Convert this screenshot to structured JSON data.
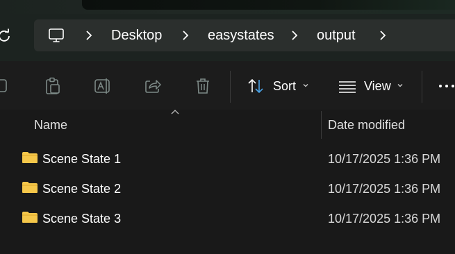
{
  "colors": {
    "background": "#191919",
    "folder": "#f5c74a",
    "text": "#ffffff"
  },
  "breadcrumb": {
    "root_icon": "monitor-icon",
    "items": [
      "Desktop",
      "easystates",
      "output"
    ]
  },
  "toolbar": {
    "sort_label": "Sort",
    "view_label": "View",
    "icons": [
      "copy-icon",
      "paste-icon",
      "rename-icon",
      "share-icon",
      "delete-icon",
      "sort-icon",
      "view-icon",
      "more-icon"
    ]
  },
  "columns": {
    "name": "Name",
    "date_modified": "Date modified"
  },
  "files": [
    {
      "name": "Scene State 1",
      "date": "10/17/2025 1:36 PM",
      "icon": "folder-icon"
    },
    {
      "name": "Scene State 2",
      "date": "10/17/2025 1:36 PM",
      "icon": "folder-icon"
    },
    {
      "name": "Scene State 3",
      "date": "10/17/2025 1:36 PM",
      "icon": "folder-icon"
    }
  ]
}
